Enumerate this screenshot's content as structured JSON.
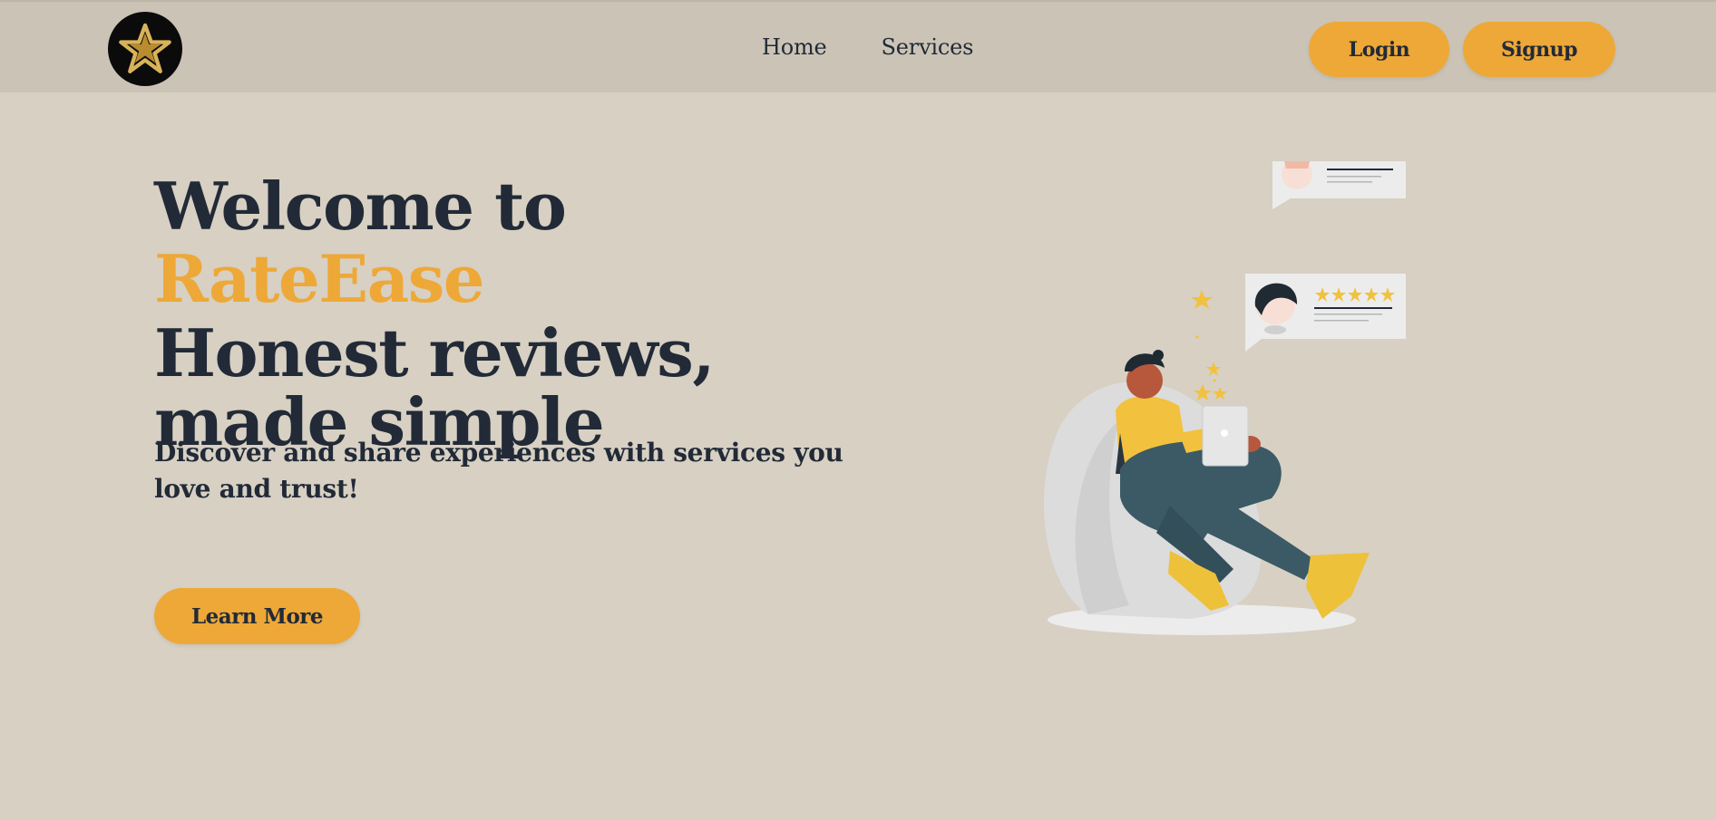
{
  "nav": {
    "links": [
      "Home",
      "Services"
    ],
    "login_label": "Login",
    "signup_label": "Signup"
  },
  "hero": {
    "title_prefix": "Welcome to ",
    "brand": "RateEase",
    "title_line2": "Honest reviews, made simple",
    "subtitle": "Discover and share experiences with services you love and trust!",
    "cta_label": "Learn More"
  },
  "colors": {
    "background": "#d7d0c3",
    "navbar": "#cbc4b6",
    "accent": "#eea837",
    "text": "#222a37"
  },
  "icons": {
    "logo": "star-logo-icon"
  }
}
